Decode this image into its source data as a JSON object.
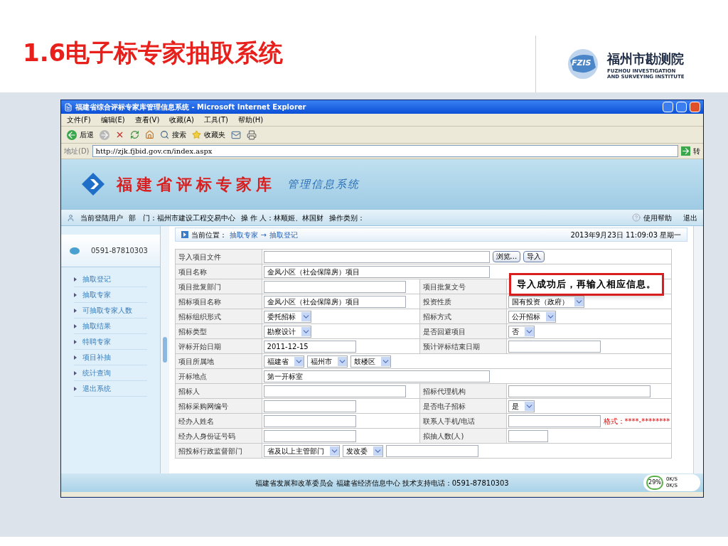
{
  "slide": {
    "title": "1.6电子标专家抽取系统",
    "logo_badge": "FZIS",
    "logo_name": "福州市勘测院",
    "logo_subtitle": "FUZHOU INVESTIGATION AND SURVEYING INSTITUTE"
  },
  "browser": {
    "title": "福建省综合评标专家库管理信息系统 - Microsoft Internet Explorer",
    "menu": [
      "文件(F)",
      "编辑(E)",
      "查看(V)",
      "收藏(A)",
      "工具(T)",
      "帮助(H)"
    ],
    "back": "后退",
    "search": "搜索",
    "favorites": "收藏夹",
    "address_label": "地址(D)",
    "url": "http://zjk.fjbid.gov.cn/index.aspx",
    "go": "转"
  },
  "site": {
    "title": "福建省评标专家库",
    "subtitle": "管理信息系统"
  },
  "user_bar": {
    "items": [
      "当前登陆用户",
      "部　门：福州市建设工程交易中心",
      "操 作 人：林顺姬、林国财",
      "操作类别："
    ],
    "help": "使用帮助",
    "logout": "退出"
  },
  "sidebar": {
    "phone": "0591-87810303",
    "items": [
      "抽取登记",
      "抽取专家",
      "可抽取专家人数",
      "抽取结果",
      "特聘专家",
      "项目补抽",
      "统计查询",
      "退出系统"
    ]
  },
  "breadcrumb": {
    "label": "当前位置：",
    "path": [
      "抽取专家",
      "→",
      "抽取登记"
    ],
    "datetime": "2013年9月23日 11:09:03 星期一"
  },
  "form": {
    "rows": [
      {
        "cells": [
          {
            "label": "导入项目文件",
            "controls": [
              {
                "kind": "wide-field"
              },
              {
                "kind": "button",
                "value": "浏览..."
              },
              {
                "kind": "button",
                "value": "导入"
              }
            ]
          }
        ]
      },
      {
        "cells": [
          {
            "label": "项目名称",
            "controls": [
              {
                "kind": "wide-field",
                "value": "金凤小区（社会保障房）项目"
              }
            ]
          }
        ]
      },
      {
        "cells": [
          {
            "label": "项目批复部门",
            "controls": [
              {
                "kind": "field"
              }
            ]
          },
          {
            "label": "项目批复文号"
          }
        ]
      },
      {
        "cells": [
          {
            "label": "招标项目名称",
            "controls": [
              {
                "kind": "field",
                "value": "金凤小区（社会保障房）项目"
              }
            ]
          },
          {
            "label": "投资性质",
            "controls": [
              {
                "kind": "select",
                "value": "国有投资（政府）"
              }
            ]
          }
        ]
      },
      {
        "cells": [
          {
            "label": "招标组织形式",
            "controls": [
              {
                "kind": "select",
                "value": "委托招标"
              }
            ]
          },
          {
            "label": "招标方式",
            "controls": [
              {
                "kind": "select",
                "value": "公开招标"
              }
            ]
          }
        ]
      },
      {
        "cells": [
          {
            "label": "招标类型",
            "controls": [
              {
                "kind": "select",
                "value": "勘察设计"
              }
            ]
          },
          {
            "label": "是否回避项目",
            "controls": [
              {
                "kind": "select",
                "value": "否"
              }
            ]
          }
        ]
      },
      {
        "cells": [
          {
            "label": "评标开始日期",
            "controls": [
              {
                "kind": "medium-field",
                "value": "2011-12-15"
              }
            ]
          },
          {
            "label": "预计评标结束日期",
            "controls": [
              {
                "kind": "medium-field"
              }
            ]
          }
        ]
      },
      {
        "cells": [
          {
            "label": "项目所属地",
            "controls": [
              {
                "kind": "select",
                "value": "福建省"
              },
              {
                "kind": "select",
                "value": "福州市"
              },
              {
                "kind": "select",
                "value": "鼓楼区"
              }
            ]
          }
        ]
      },
      {
        "cells": [
          {
            "label": "开标地点",
            "controls": [
              {
                "kind": "wide-field",
                "value": "第一开标室"
              }
            ]
          }
        ]
      },
      {
        "cells": [
          {
            "label": "招标人",
            "controls": [
              {
                "kind": "field"
              }
            ]
          },
          {
            "label": "招标代理机构",
            "controls": [
              {
                "kind": "field"
              }
            ]
          }
        ]
      },
      {
        "cells": [
          {
            "label": "招标采购网编号",
            "controls": [
              {
                "kind": "medium-field"
              }
            ]
          },
          {
            "label": "是否电子招标",
            "controls": [
              {
                "kind": "select",
                "value": "是"
              }
            ]
          }
        ]
      },
      {
        "cells": [
          {
            "label": "经办人姓名",
            "controls": [
              {
                "kind": "medium-field"
              }
            ]
          },
          {
            "label": "联系人手机/电话",
            "controls": [
              {
                "kind": "medium-field"
              },
              {
                "kind": "hint",
                "value": "格式：****-********"
              }
            ]
          }
        ]
      },
      {
        "cells": [
          {
            "label": "经办人身份证号码",
            "controls": [
              {
                "kind": "medium-field"
              }
            ]
          },
          {
            "label": "拟抽人数(人)",
            "controls": [
              {
                "kind": "short-field"
              }
            ]
          }
        ]
      },
      {
        "cells": [
          {
            "label": "招投标行政监督部门",
            "controls": [
              {
                "kind": "select",
                "value": "省及以上主管部门"
              },
              {
                "kind": "select",
                "value": "发改委"
              },
              {
                "kind": "medium-field"
              }
            ]
          }
        ]
      }
    ]
  },
  "callout": "导入成功后，再输入相应信息。",
  "footer": "福建省发展和改革委员会 福建省经济信息中心 技术支持电话：0591-87810303",
  "net_meter": {
    "percent": "29%",
    "up": "0K/S",
    "down": "0K/S"
  }
}
